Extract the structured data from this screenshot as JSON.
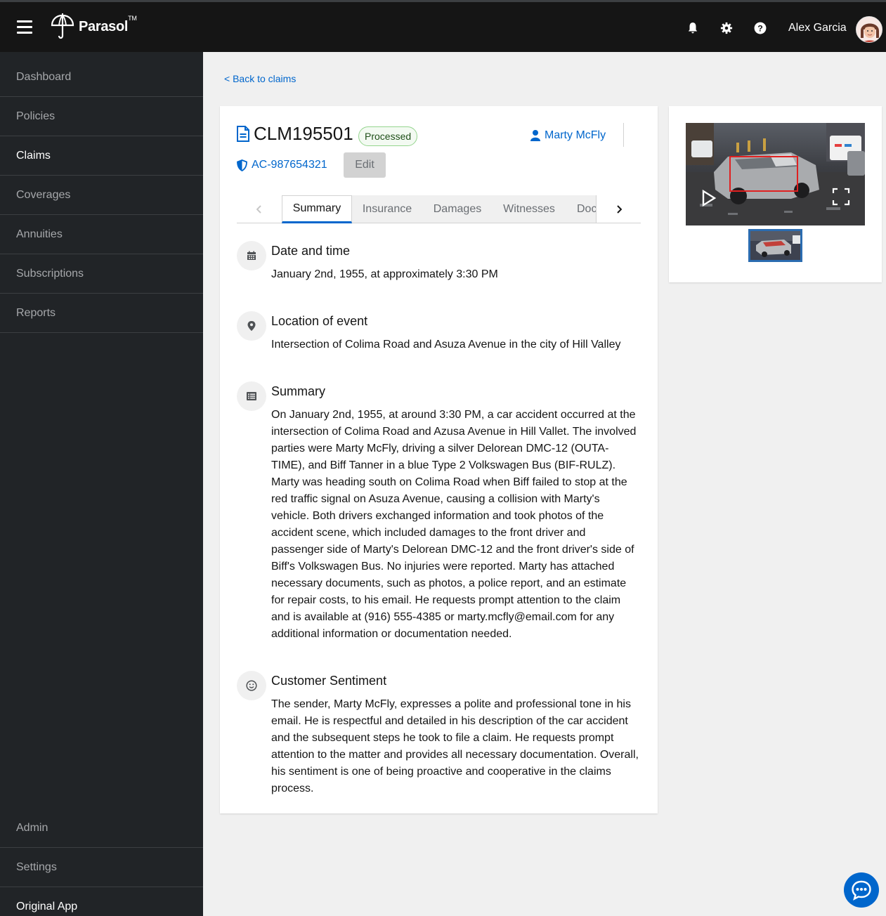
{
  "header": {
    "brand": "Parasol",
    "brand_tm": "TM",
    "user_name": "Alex Garcia",
    "icons": [
      "menu-icon",
      "bell-icon",
      "gear-icon",
      "help-icon"
    ]
  },
  "sidebar": {
    "items": [
      {
        "label": "Dashboard"
      },
      {
        "label": "Policies"
      },
      {
        "label": "Claims"
      },
      {
        "label": "Coverages"
      },
      {
        "label": "Annuities"
      },
      {
        "label": "Subscriptions"
      },
      {
        "label": "Reports"
      }
    ],
    "bottom_items": [
      {
        "label": "Admin"
      },
      {
        "label": "Settings"
      },
      {
        "label": "Original App"
      }
    ]
  },
  "back_link": "< Back to claims",
  "claim": {
    "id": "CLM195501",
    "status": "Processed",
    "claimant": "Marty McFly",
    "policy": "AC-987654321",
    "edit_label": "Edit"
  },
  "tabs": [
    {
      "label": "Summary"
    },
    {
      "label": "Insurance"
    },
    {
      "label": "Damages"
    },
    {
      "label": "Witnesses"
    },
    {
      "label": "Doc"
    }
  ],
  "sections": [
    {
      "icon": "calendar-icon",
      "title": "Date and time",
      "body": "January 2nd, 1955, at approximately 3:30 PM"
    },
    {
      "icon": "location-pin-icon",
      "title": "Location of event",
      "body": "Intersection of Colima Road and Asuza Avenue in the city of Hill Valley"
    },
    {
      "icon": "list-icon",
      "title": "Summary",
      "body": "On January 2nd, 1955, at around 3:30 PM, a car accident occurred at the intersection of Colima Road and Azusa Avenue in Hill Vallet. The involved parties were Marty McFly, driving a silver Delorean DMC-12 (OUTA-TIME), and Biff Tanner in a blue Type 2 Volkswagen Bus (BIF-RULZ). Marty was heading south on Colima Road when Biff failed to stop at the red traffic signal on Asuza Avenue, causing a collision with Marty's vehicle. Both drivers exchanged information and took photos of the accident scene, which included damages to the front driver and passenger side of Marty's Delorean DMC-12 and the front driver's side of Biff's Volkswagen Bus. No injuries were reported. Marty has attached necessary documents, such as photos, a police report, and an estimate for repair costs, to his email. He requests prompt attention to the claim and is available at (916) 555-4385 or marty.mcfly@email.com for any additional information or documentation needed."
    },
    {
      "icon": "smile-icon",
      "title": "Customer Sentiment",
      "body": "The sender, Marty McFly, expresses a polite and professional tone in his email. He is respectful and detailed in his description of the car accident and the subsequent steps he took to file a claim. He requests prompt attention to the matter and provides all necessary documentation. Overall, his sentiment is one of being proactive and cooperative in the claims process."
    }
  ],
  "colors": {
    "accent": "#0066cc",
    "topbar": "#151515",
    "sidebar": "#212427",
    "status_green": "#95d58e"
  }
}
